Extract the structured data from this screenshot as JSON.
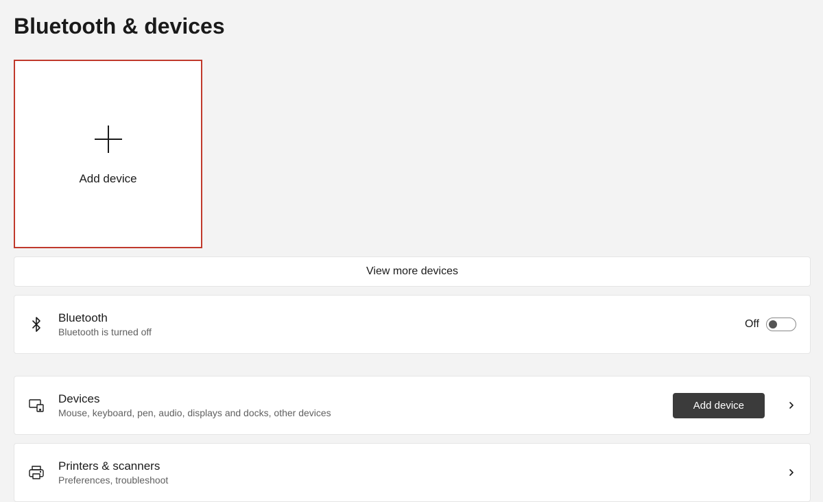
{
  "title": "Bluetooth & devices",
  "add_tile": {
    "label": "Add device"
  },
  "view_more": {
    "label": "View more devices"
  },
  "bluetooth": {
    "title": "Bluetooth",
    "subtitle": "Bluetooth is turned off",
    "state_label": "Off"
  },
  "devices": {
    "title": "Devices",
    "subtitle": "Mouse, keyboard, pen, audio, displays and docks, other devices",
    "button_label": "Add device"
  },
  "printers": {
    "title": "Printers & scanners",
    "subtitle": "Preferences, troubleshoot"
  }
}
